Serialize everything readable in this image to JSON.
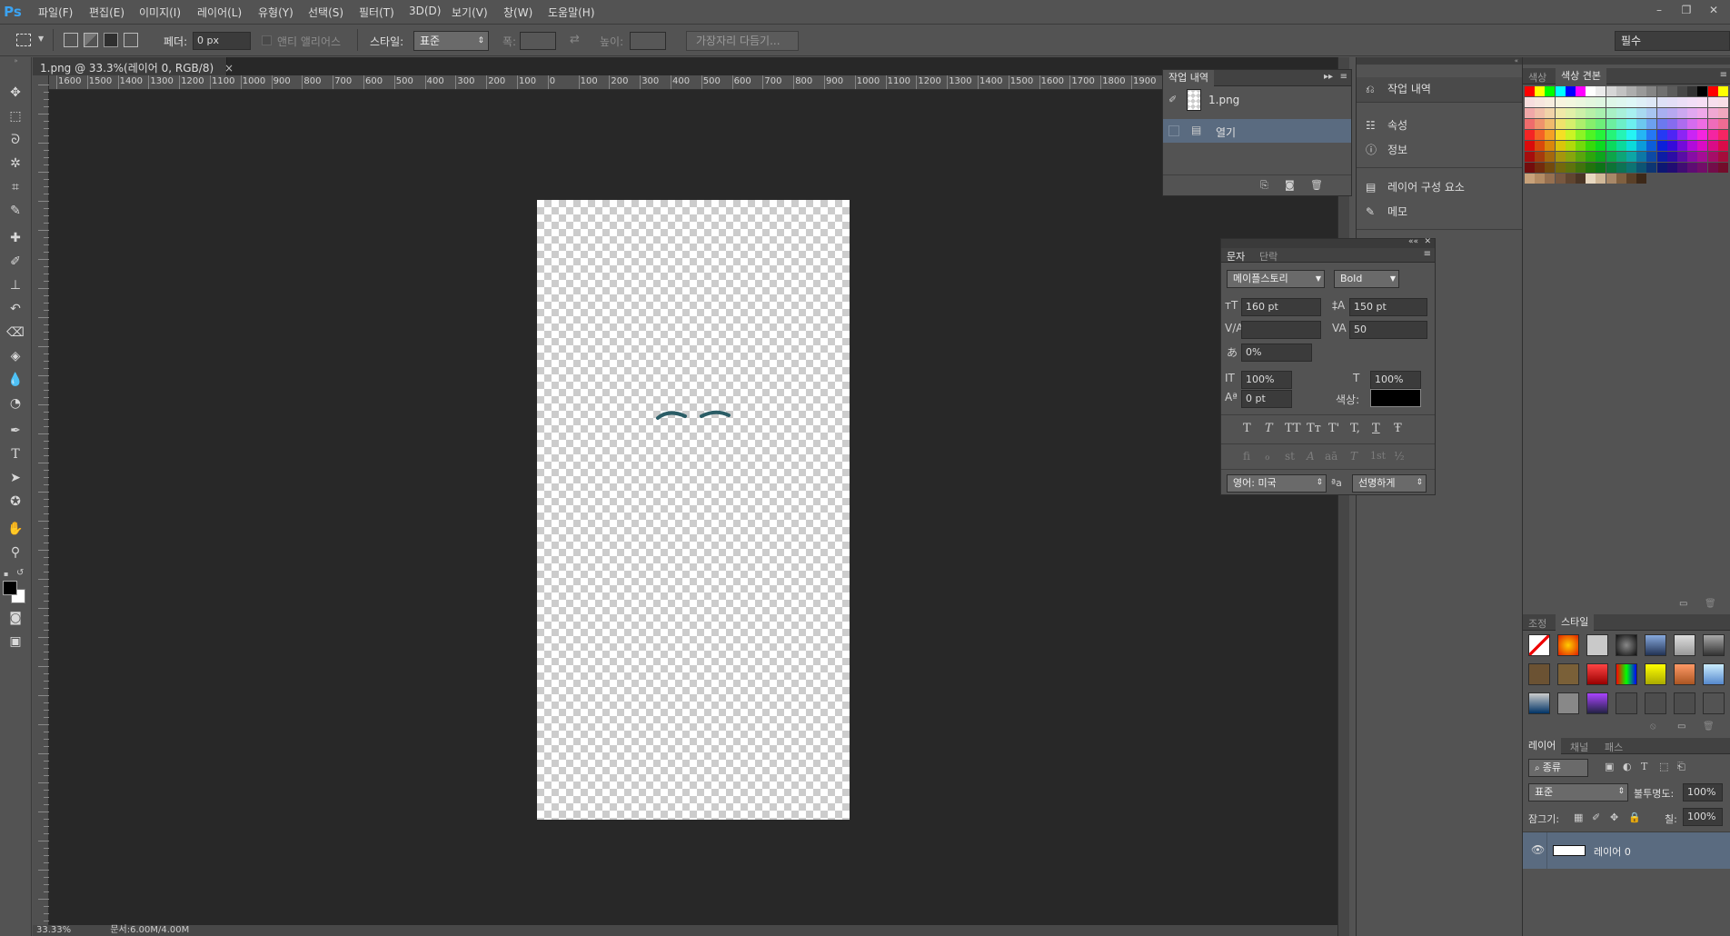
{
  "app": {
    "logo": "Ps"
  },
  "menubar": {
    "items": [
      "파일(F)",
      "편집(E)",
      "이미지(I)",
      "레이어(L)",
      "유형(Y)",
      "선택(S)",
      "필터(T)",
      "3D(D)",
      "보기(V)",
      "창(W)",
      "도움말(H)"
    ],
    "window_controls": [
      "–",
      "❐",
      "✕"
    ]
  },
  "options": {
    "feather_label": "페더:",
    "feather_value": "0 px",
    "antialias_label": "앤티 앨리어스",
    "style_label": "스타일:",
    "style_value": "표준",
    "width_label": "폭:",
    "height_label": "높이:",
    "refine_edge_button": "가장자리 다듬기...",
    "workspace": "필수"
  },
  "document": {
    "tab_title": "1.png @ 33.3%(레이어 0, RGB/8)",
    "tab_close": "×",
    "zoom": "33.33%",
    "status": "문서:6.00M/4.00M",
    "ruler_top": [
      "1600",
      "1500",
      "1400",
      "1300",
      "1200",
      "1100",
      "1000",
      "900",
      "800",
      "700",
      "600",
      "500",
      "400",
      "300",
      "200",
      "100",
      "0",
      "100",
      "200",
      "300",
      "400",
      "500",
      "600",
      "700",
      "800",
      "900",
      "1000",
      "1100",
      "1200",
      "1300",
      "1400",
      "1500",
      "1600",
      "1700",
      "1800",
      "1900",
      "200"
    ]
  },
  "history": {
    "tabs": [
      "작업 내역"
    ],
    "snapshot_label": "1.png",
    "steps": [
      "열기"
    ]
  },
  "dock_mid": {
    "items": [
      {
        "icon": "history-icon",
        "label": "작업 내역"
      },
      {
        "icon": "properties-icon",
        "label": "속성"
      },
      {
        "icon": "info-icon",
        "label": "정보"
      },
      {
        "icon": "layer-comps-icon",
        "label": "레이어 구성 요소"
      },
      {
        "icon": "notes-icon",
        "label": "메모"
      }
    ]
  },
  "character": {
    "tabs": [
      "문자",
      "단락"
    ],
    "font_family": "메이플스토리",
    "font_style": "Bold",
    "font_size": "160 pt",
    "leading": "150 pt",
    "kerning": "",
    "tracking": "50",
    "tsume": "0%",
    "vertical_scale": "100%",
    "horizontal_scale": "100%",
    "baseline_shift": "0 pt",
    "color_label": "색상:",
    "color": "#000000",
    "style_buttons": [
      "T",
      "T",
      "TT",
      "Tт",
      "T'",
      "T,",
      "T",
      "Ŧ"
    ],
    "opentype_buttons": [
      "fi",
      "ℴ",
      "st",
      "A",
      "aā",
      "T",
      "1st",
      "½"
    ],
    "language": "영어: 미국",
    "aa_icon": "ªa",
    "antialias": "선명하게"
  },
  "swatches_panel": {
    "tabs": [
      "색상",
      "색상 견본"
    ]
  },
  "styles_panel": {
    "tabs": [
      "조정",
      "스타일"
    ]
  },
  "layers_panel": {
    "tabs": [
      "레이어",
      "채널",
      "패스"
    ],
    "filter_kind": "종류",
    "blend_mode": "표준",
    "opacity_label": "불투명도:",
    "opacity": "100%",
    "lock_label": "잠그기:",
    "fill_label": "칠:",
    "fill": "100%",
    "layers": [
      {
        "name": "레이어 0",
        "visible": true
      }
    ]
  },
  "colors": {
    "accent": "#3ba3f2",
    "selected_row": "#5a6b80",
    "eyebrow": "#2b5d66"
  }
}
